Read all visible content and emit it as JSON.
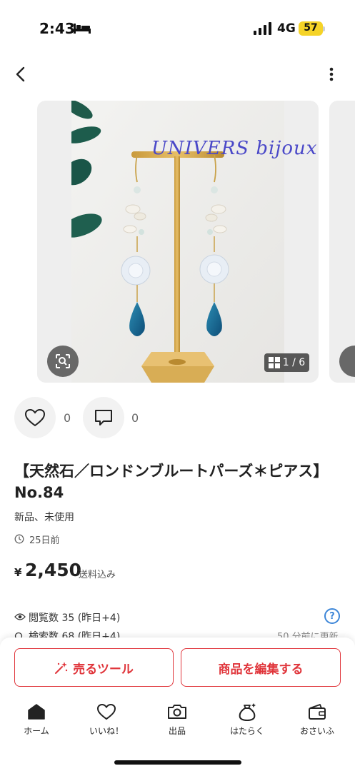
{
  "status_bar": {
    "time": "2:43",
    "network": "4G",
    "battery": "57"
  },
  "gallery": {
    "watermark": "UNIVERS bijoux",
    "counter": "1 / 6"
  },
  "actions": {
    "like_count": "0",
    "comment_count": "0"
  },
  "item": {
    "title": "【天然石／ロンドンブルートパーズ＊ピアス】No.84",
    "condition": "新品、未使用",
    "posted": "25日前",
    "price_currency": "¥",
    "price": "2,450",
    "shipping": "送料込み"
  },
  "stats": {
    "views": "閲覧数  35 (昨日+4)",
    "searches": "検索数  68 (昨日+4)",
    "updated": "50 分前に更新",
    "help": "?"
  },
  "buttons": {
    "sell_tool": "売るツール",
    "edit": "商品を編集する"
  },
  "tabs": [
    {
      "label": "ホーム",
      "icon": "home-icon"
    },
    {
      "label": "いいね！",
      "icon": "heart-icon"
    },
    {
      "label": "出品",
      "icon": "camera-icon"
    },
    {
      "label": "はたらく",
      "icon": "money-bag-icon"
    },
    {
      "label": "おさいふ",
      "icon": "wallet-icon"
    }
  ],
  "colors": {
    "accent": "#e0353b",
    "battery": "#f5d327",
    "help": "#3d86d8"
  }
}
